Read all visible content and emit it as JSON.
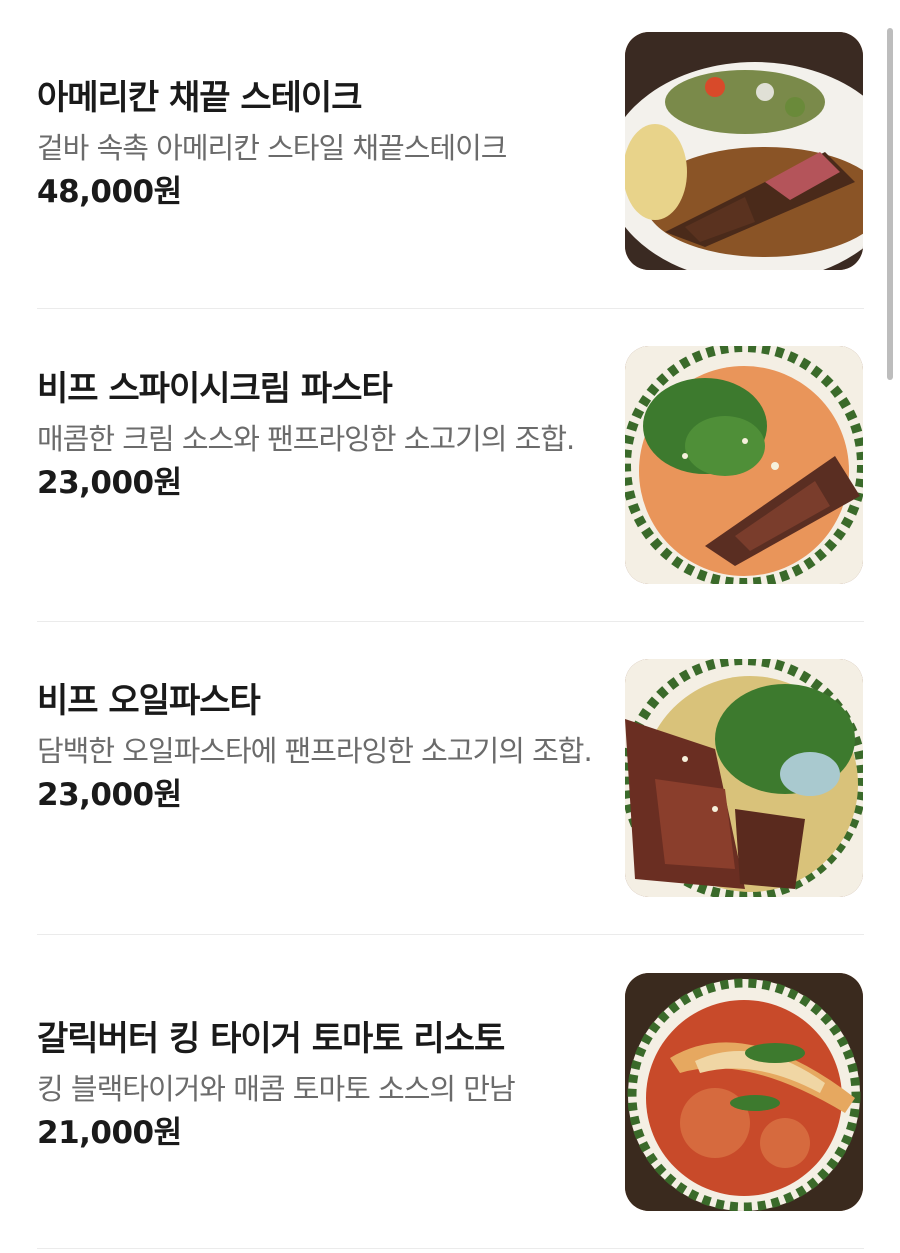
{
  "menu": {
    "items": [
      {
        "name": "아메리칸 채끝 스테이크",
        "desc": "겉바 속촉 아메리칸 스타일 채끝스테이크",
        "price": "48,000원",
        "image_icon": "steak-plate-image"
      },
      {
        "name": "비프 스파이시크림 파스타",
        "desc": "매콤한 크림 소스와 팬프라잉한 소고기의 조합.",
        "price": "23,000원",
        "image_icon": "spicy-cream-pasta-image"
      },
      {
        "name": "비프 오일파스타",
        "desc": "담백한 오일파스타에 팬프라잉한 소고기의 조합.",
        "price": "23,000원",
        "image_icon": "oil-pasta-image"
      },
      {
        "name": "갈릭버터 킹 타이거 토마토 리소토",
        "desc": "킹 블랙타이거와 매콤 토마토 소스의 만남",
        "price": "21,000원",
        "image_icon": "tomato-risotto-image"
      }
    ]
  },
  "colors": {
    "text_primary": "#1a1a1a",
    "text_secondary": "#6b6b6b",
    "divider": "#ebebeb",
    "scrollbar": "#bdbdbd"
  }
}
